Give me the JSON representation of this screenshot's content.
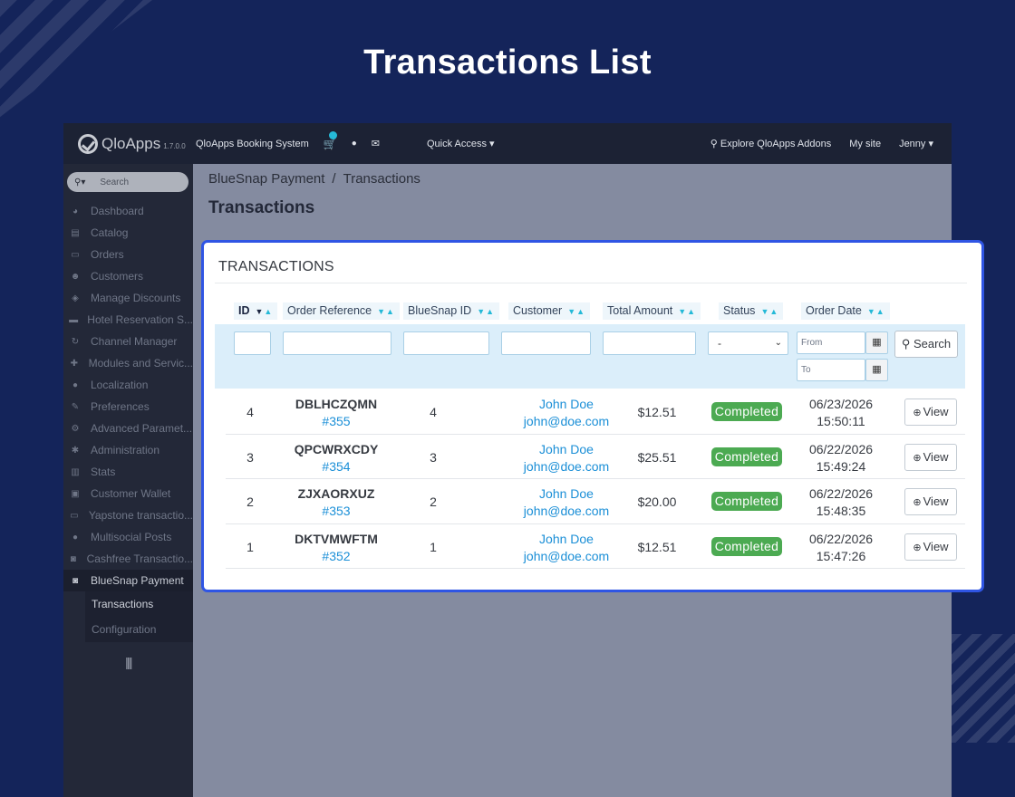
{
  "hero_title": "Transactions List",
  "topbar": {
    "logo_text": "QloApps",
    "logo_version": "1.7.0.0",
    "app_name": "QloApps Booking System",
    "cart_badge": "",
    "quick_access": "Quick Access ▾",
    "explore": "Explore QloApps Addons",
    "my_site": "My site",
    "user": "Jenny ▾"
  },
  "sidebar": {
    "search_placeholder": "Search",
    "items": [
      {
        "label": "Dashboard",
        "icon": "dashboard-icon",
        "glyph": "◕"
      },
      {
        "label": "Catalog",
        "icon": "book-icon",
        "glyph": "▤"
      },
      {
        "label": "Orders",
        "icon": "credit-card-icon",
        "glyph": "▭"
      },
      {
        "label": "Customers",
        "icon": "users-icon",
        "glyph": "☻"
      },
      {
        "label": "Manage Discounts",
        "icon": "tag-icon",
        "glyph": "◈"
      },
      {
        "label": "Hotel Reservation S...",
        "icon": "bed-icon",
        "glyph": "▬"
      },
      {
        "label": "Channel Manager",
        "icon": "refresh-icon",
        "glyph": "↻"
      },
      {
        "label": "Modules and Servic...",
        "icon": "puzzle-icon",
        "glyph": "✚"
      },
      {
        "label": "Localization",
        "icon": "globe-icon",
        "glyph": "●"
      },
      {
        "label": "Preferences",
        "icon": "wrench-icon",
        "glyph": "✎"
      },
      {
        "label": "Advanced Paramet...",
        "icon": "cogs-icon",
        "glyph": "⚙"
      },
      {
        "label": "Administration",
        "icon": "gear-icon",
        "glyph": "✱"
      },
      {
        "label": "Stats",
        "icon": "bar-chart-icon",
        "glyph": "▥"
      },
      {
        "label": "Customer Wallet",
        "icon": "briefcase-icon",
        "glyph": "▣"
      },
      {
        "label": "Yapstone transactio...",
        "icon": "credit-card-icon",
        "glyph": "▭"
      },
      {
        "label": "Multisocial Posts",
        "icon": "globe-icon",
        "glyph": "●"
      },
      {
        "label": "Cashfree Transactio...",
        "icon": "money-icon",
        "glyph": "◙"
      },
      {
        "label": "BlueSnap Payment",
        "icon": "money-icon",
        "glyph": "◙"
      }
    ],
    "sub_items": [
      "Transactions",
      "Configuration"
    ]
  },
  "breadcrumb": {
    "parent": "BlueSnap Payment",
    "sep": "/",
    "current": "Transactions"
  },
  "page_title": "Transactions",
  "panel": {
    "heading": "TRANSACTIONS",
    "columns": [
      "ID",
      "Order Reference",
      "BlueSnap ID",
      "Customer",
      "Total Amount",
      "Status",
      "Order Date"
    ],
    "status_filter_value": "-",
    "date_from_placeholder": "From",
    "date_to_placeholder": "To",
    "search_label": "Search",
    "view_label": "View",
    "rows": [
      {
        "id": "4",
        "ref": "DBLHCZQMN",
        "order": "#355",
        "bluesnap_id": "4",
        "customer": "John Doe",
        "email": "john@doe.com",
        "amount": "$12.51",
        "status": "Completed",
        "date": "06/23/2026",
        "time": "15:50:11"
      },
      {
        "id": "3",
        "ref": "QPCWRXCDY",
        "order": "#354",
        "bluesnap_id": "3",
        "customer": "John Doe",
        "email": "john@doe.com",
        "amount": "$25.51",
        "status": "Completed",
        "date": "06/22/2026",
        "time": "15:49:24"
      },
      {
        "id": "2",
        "ref": "ZJXAORXUZ",
        "order": "#353",
        "bluesnap_id": "2",
        "customer": "John Doe",
        "email": "john@doe.com",
        "amount": "$20.00",
        "status": "Completed",
        "date": "06/22/2026",
        "time": "15:48:35"
      },
      {
        "id": "1",
        "ref": "DKTVMWFTM",
        "order": "#352",
        "bluesnap_id": "1",
        "customer": "John Doe",
        "email": "john@doe.com",
        "amount": "$12.51",
        "status": "Completed",
        "date": "06/22/2026",
        "time": "15:47:26"
      }
    ]
  },
  "colors": {
    "accent": "#25b9d7",
    "status_completed": "#4caa52",
    "highlight_border": "#2f55e4",
    "background": "#14245a"
  }
}
